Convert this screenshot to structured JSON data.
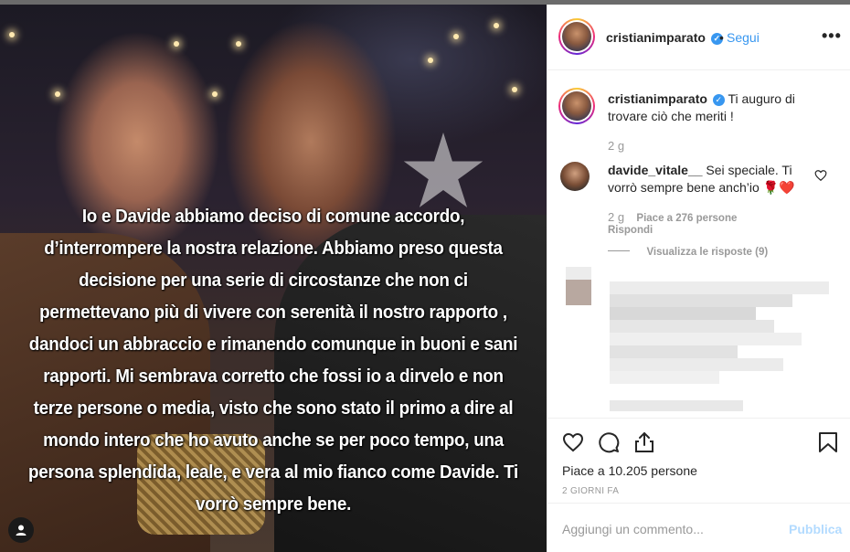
{
  "post": {
    "photo_caption_lines": [
      "Io e Davide abbiamo deciso di comune accordo,",
      "d’interrompere la nostra relazione. Abbiamo preso questa",
      "decisione per una serie di circostanze che non ci",
      "permettevano più di vivere con serenità il nostro rapporto ,",
      "dandoci un abbraccio e rimanendo comunque in buoni e sani",
      "rapporti. Mi sembrava corretto che fossi io a dirvelo e non",
      "terze persone o media,  visto che sono stato il primo a dire al",
      "mondo intero che ho avuto anche se per poco tempo, una",
      "persona splendida, leale, e vera al mio fianco come Davide. Ti",
      "vorrò sempre bene."
    ],
    "user_tag_icon": "person-icon"
  },
  "header": {
    "username": "cristianimparato",
    "verified_icon": "verified-badge-icon",
    "separator": "•",
    "follow_label": "Segui",
    "more_icon": "more-options-icon",
    "more_glyph": "•••"
  },
  "caption": {
    "username": "cristianimparato",
    "text": "Ti auguro di trovare ciò che meriti !",
    "time": "2 g"
  },
  "comment": {
    "username": "davide_vitale__",
    "text": "Sei speciale. Ti vorrò sempre bene anch’io 🌹❤️",
    "time": "2 g",
    "likes": "Piace a 276 persone",
    "reply_label": "Rispondi",
    "view_replies_label": "Visualizza le risposte (9)"
  },
  "actions": {
    "like_icon": "heart-icon",
    "comment_icon": "comment-icon",
    "share_icon": "share-icon",
    "save_icon": "bookmark-icon",
    "likes_text": "Piace a 10.205 persone",
    "date_text": "2 GIORNI FA"
  },
  "composer": {
    "placeholder": "Aggiungi un commento...",
    "publish_label": "Pubblica"
  },
  "colors": {
    "link_blue": "#3897f0",
    "publish_disabled": "#b3dbff",
    "text": "#262626",
    "muted": "#999999"
  }
}
